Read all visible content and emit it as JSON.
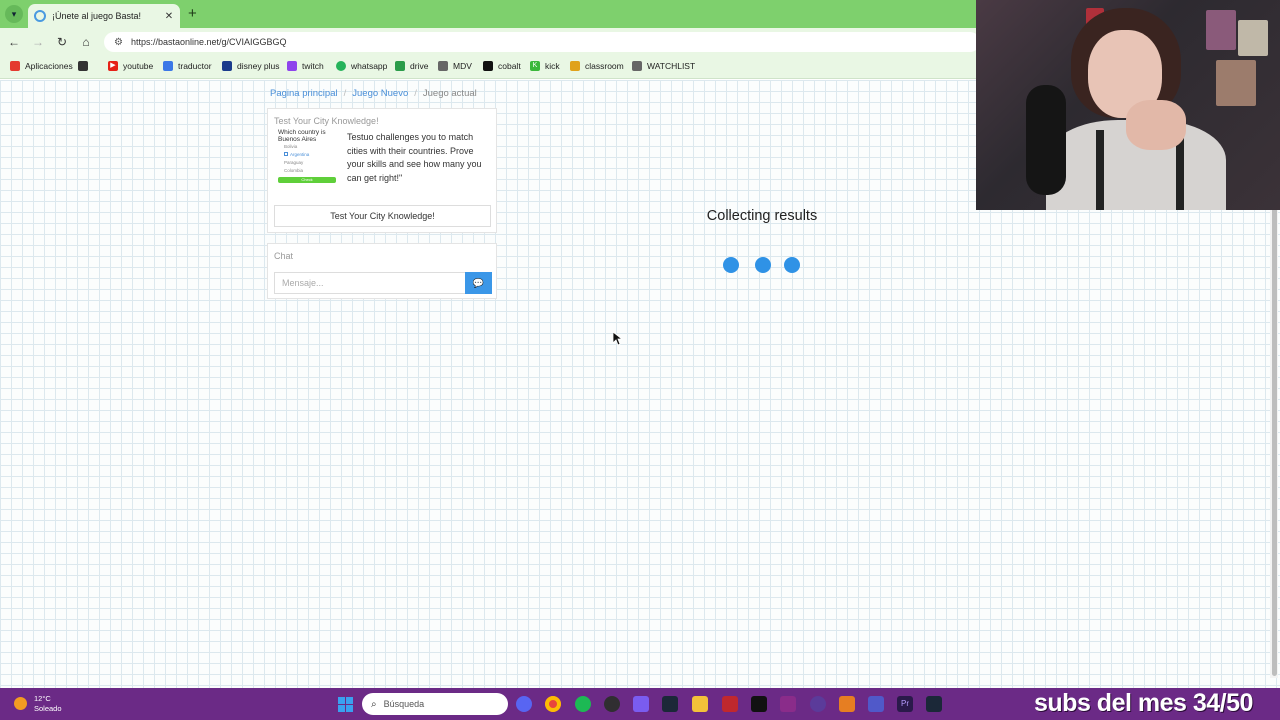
{
  "browser": {
    "tab_title": "¡Únete al juego Basta!",
    "new_tab_symbol": "+",
    "close_symbol": "✕",
    "url": "https://bastaonline.net/g/CVIAIGGBGQ"
  },
  "bookmarks": [
    {
      "label": "Aplicaciones",
      "color": "#e43a2f"
    },
    {
      "label": "",
      "color": "#333333"
    },
    {
      "label": "youtube",
      "color": "#e62117"
    },
    {
      "label": "traductor",
      "color": "#3b78e7"
    },
    {
      "label": "disney plus",
      "color": "#1a3b8c"
    },
    {
      "label": "twitch",
      "color": "#8e44ec"
    },
    {
      "label": "whatsapp",
      "color": "#25b35a"
    },
    {
      "label": "drive",
      "color": "#2b9c4a"
    },
    {
      "label": "MDV",
      "color": "#666666"
    },
    {
      "label": "cobalt",
      "color": "#111111"
    },
    {
      "label": "kick",
      "color": "#3bb83b"
    },
    {
      "label": "classroom",
      "color": "#e0a21a"
    },
    {
      "label": "WATCHLIST",
      "color": "#666666"
    }
  ],
  "breadcrumb": {
    "home": "Pagina principal",
    "new_game": "Juego Nuevo",
    "current": "Juego actual",
    "separator": "/"
  },
  "promo": {
    "heading": "Test Your City Knowledge!",
    "thumb_question": "Which country is Buenos Aires",
    "thumb_options": [
      "Bolivia",
      "Argentina",
      "Paraguay",
      "Colombia"
    ],
    "thumb_button": "Check",
    "text": "Testuo challenges you to match cities with their countries. Prove your skills and see how many you can get right!\"",
    "button_label": "Test Your City Knowledge!"
  },
  "chat": {
    "heading": "Chat",
    "placeholder": "Mensaje..."
  },
  "status": {
    "title": "Collecting results"
  },
  "taskbar": {
    "temperature": "12°C",
    "weather": "Soleado",
    "search_placeholder": "Búsqueda",
    "overlay_text": "subs del mes 34/50"
  },
  "colors": {
    "accent": "#2f92e6",
    "tabbar": "#7ed06d",
    "taskbar": "#6b2a86"
  }
}
